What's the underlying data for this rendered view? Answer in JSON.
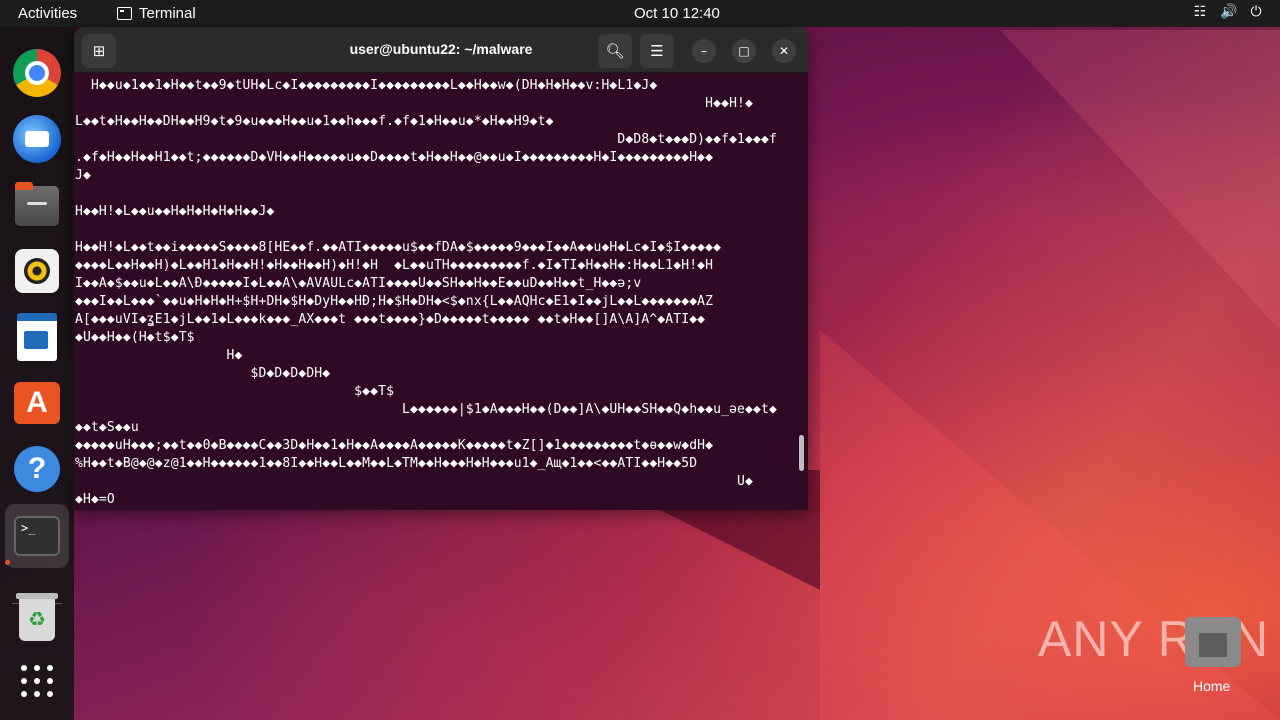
{
  "topbar": {
    "activities": "Activities",
    "app_name": "Terminal",
    "clock": "Oct 10  12:40",
    "tray_icons": [
      "network-icon",
      "volume-icon",
      "power-icon"
    ]
  },
  "dock": {
    "items": [
      "Google Chrome",
      "Thunderbird Mail",
      "Files",
      "Rhythmbox",
      "LibreOffice Writer",
      "Ubuntu Software",
      "Help",
      "Terminal",
      "Trash",
      "Show Applications"
    ]
  },
  "window": {
    "title": "user@ubuntu22: ~/malware",
    "lines": [
      "  H◆◆u◆1◆◆1◆H◆◆t◆◆9◆tUH◆Lc◆I◆◆◆◆◆◆◆◆◆I◆◆◆◆◆◆◆◆◆L◆◆H◆◆w◆(DH◆H◆H◆◆v:H◆L1◆J◆",
      "                                                                               H◆◆H!◆",
      "L◆◆t◆H◆◆H◆◆DH◆◆H9◆t◆9◆u◆◆◆H◆◆u◆1◆◆h◆◆◆f.◆f◆1◆H◆◆u◆*◆H◆◆H9◆t◆",
      "                                                                    D◆D8◆t◆◆◆D)◆◆f◆1◆◆◆f",
      ".◆f◆H◆◆H◆◆H1◆◆t;◆◆◆◆◆◆D◆VH◆◆H◆◆◆◆◆u◆◆D◆◆◆◆t◆H◆◆H◆◆@◆◆u◆I◆◆◆◆◆◆◆◆◆H◆I◆◆◆◆◆◆◆◆◆H◆◆",
      "J◆",
      "",
      "H◆◆H!◆L◆◆u◆◆H◆H◆H◆H◆H◆◆J◆",
      "",
      "H◆◆H!◆L◆◆t◆◆i◆◆◆◆◆S◆◆◆◆8[HE◆◆f.◆◆ATI◆◆◆◆◆u$◆◆fDA◆$◆◆◆◆◆9◆◆◆I◆◆A◆◆u◆H◆Lc◆I◆$I◆◆◆◆◆",
      "◆◆◆◆L◆◆H◆◆H)◆L◆◆H1◆H◆◆H!◆H◆◆H◆◆H)◆H!◆H  ◆L◆◆uTH◆◆◆◆◆◆◆◆◆f.◆I◆TI◆H◆◆H◆:H◆◆L1◆H!◆H",
      "I◆◆A◆$◆◆u◆L◆◆A\\Đ◆◆◆◆◆I◆L◆◆A\\◆AVAULc◆ATI◆◆◆◆U◆◆SH◆◆H◆◆E◆◆uD◆◆H◆◆t_H◆◆ə;v",
      "◆◆◆I◆◆L◆◆◆`◆◆u◆H◆H◆H+$H+DH◆$H◆DyH◆◆HĐ;H◆$H◆DH◆<$◆nx{L◆◆AQHc◆E1◆I◆◆jL◆◆L◆◆◆◆◆◆◆AZ",
      "A[◆◆◆uVI◆ʓE1◆jL◆◆1◆L◆◆◆k◆◆◆_AX◆◆◆t ◆◆◆t◆◆◆◆}◆D◆◆◆◆◆t◆◆◆◆◆ ◆◆t◆H◆◆[]A\\A]A^◆ATI◆◆",
      "◆U◆◆H◆◆(H◆t$◆T$",
      "                   H◆",
      "                      $D◆D◆D◆DH◆",
      "                                   $◆◆T$",
      "                                         L◆◆◆◆◆◆|$1◆A◆◆◆H◆◆(D◆◆]A\\◆UH◆◆SH◆◆Q◆h◆◆u_əe◆◆t◆",
      "◆◆t◆S◆◆u",
      "◆◆◆◆◆uH◆◆◆;◆◆t◆◆0◆B◆◆◆◆C◆◆3D◆H◆◆1◆H◆◆A◆◆◆◆A◆◆◆◆◆K◆◆◆◆◆t◆Z[]◆1◆◆◆◆◆◆◆◆◆t◆ɵ◆◆w◆dH◆",
      "%H◆◆t◆B@◆@◆z@1◆◆H◆◆◆◆◆◆1◆◆8I◆◆H◆◆L◆◆M◆◆L◆TM◆◆H◆◆◆H◆H◆◆◆u1◆_Aщ◆1◆◆<◆◆ATI◆◆H◆◆5D",
      "                                                                                   U◆",
      "◆H◆=O"
    ]
  },
  "watermark": "ANY RUN",
  "desktop": {
    "home_label": "Home"
  }
}
